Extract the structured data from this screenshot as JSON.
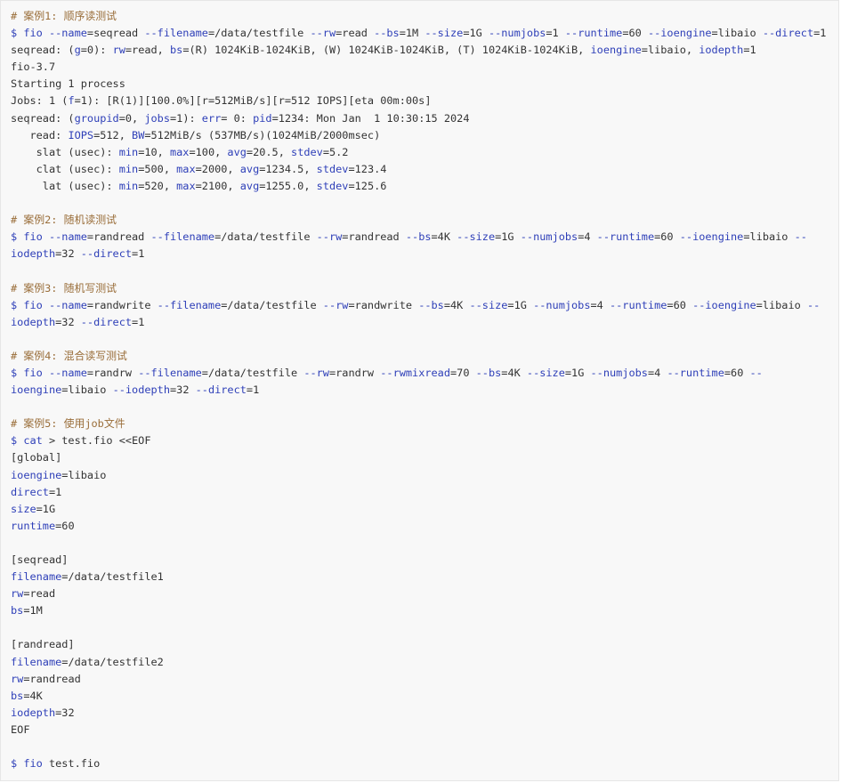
{
  "colors": {
    "background": "#f8f8f8",
    "border": "#e6e6e6",
    "text": "#333333",
    "comment": "#9a6e3a",
    "keyword": "#2e3fb8"
  },
  "lines": [
    [
      {
        "t": "comment",
        "v": "# 案例1: 顺序读测试"
      }
    ],
    [
      {
        "t": "prompt",
        "v": "$ fio "
      },
      {
        "t": "key",
        "v": "--name"
      },
      {
        "t": "plain",
        "v": "=seqread "
      },
      {
        "t": "key",
        "v": "--filename"
      },
      {
        "t": "plain",
        "v": "=/data/testfile "
      },
      {
        "t": "key",
        "v": "--rw"
      },
      {
        "t": "plain",
        "v": "=read "
      },
      {
        "t": "key",
        "v": "--bs"
      },
      {
        "t": "plain",
        "v": "=1M "
      },
      {
        "t": "key",
        "v": "--size"
      },
      {
        "t": "plain",
        "v": "=1G "
      },
      {
        "t": "key",
        "v": "--numjobs"
      },
      {
        "t": "plain",
        "v": "=1 "
      },
      {
        "t": "key",
        "v": "--runtime"
      },
      {
        "t": "plain",
        "v": "=60 "
      },
      {
        "t": "key",
        "v": "--ioengine"
      },
      {
        "t": "plain",
        "v": "=libaio "
      },
      {
        "t": "key",
        "v": "--direct"
      },
      {
        "t": "plain",
        "v": "=1"
      }
    ],
    [
      {
        "t": "plain",
        "v": "seqread: ("
      },
      {
        "t": "key",
        "v": "g"
      },
      {
        "t": "plain",
        "v": "=0): "
      },
      {
        "t": "key",
        "v": "rw"
      },
      {
        "t": "plain",
        "v": "=read, "
      },
      {
        "t": "key",
        "v": "bs"
      },
      {
        "t": "plain",
        "v": "=(R) 1024KiB-1024KiB, (W) 1024KiB-1024KiB, (T) 1024KiB-1024KiB, "
      },
      {
        "t": "key",
        "v": "ioengine"
      },
      {
        "t": "plain",
        "v": "=libaio, "
      },
      {
        "t": "key",
        "v": "iodepth"
      },
      {
        "t": "plain",
        "v": "=1"
      }
    ],
    [
      {
        "t": "plain",
        "v": "fio-3.7"
      }
    ],
    [
      {
        "t": "plain",
        "v": "Starting 1 process"
      }
    ],
    [
      {
        "t": "plain",
        "v": "Jobs: 1 ("
      },
      {
        "t": "key",
        "v": "f"
      },
      {
        "t": "plain",
        "v": "=1): [R(1)][100.0%][r=512MiB/s][r=512 IOPS][eta 00m:00s]"
      }
    ],
    [
      {
        "t": "plain",
        "v": "seqread: ("
      },
      {
        "t": "key",
        "v": "groupid"
      },
      {
        "t": "plain",
        "v": "=0, "
      },
      {
        "t": "key",
        "v": "jobs"
      },
      {
        "t": "plain",
        "v": "=1): "
      },
      {
        "t": "key",
        "v": "err"
      },
      {
        "t": "plain",
        "v": "= 0: "
      },
      {
        "t": "key",
        "v": "pid"
      },
      {
        "t": "plain",
        "v": "=1234: Mon Jan  1 10:30:15 2024"
      }
    ],
    [
      {
        "t": "plain",
        "v": "   read: "
      },
      {
        "t": "key",
        "v": "IOPS"
      },
      {
        "t": "plain",
        "v": "=512, "
      },
      {
        "t": "key",
        "v": "BW"
      },
      {
        "t": "plain",
        "v": "=512MiB/s (537MB/s)(1024MiB/2000msec)"
      }
    ],
    [
      {
        "t": "plain",
        "v": "    slat (usec): "
      },
      {
        "t": "key",
        "v": "min"
      },
      {
        "t": "plain",
        "v": "=10, "
      },
      {
        "t": "key",
        "v": "max"
      },
      {
        "t": "plain",
        "v": "=100, "
      },
      {
        "t": "key",
        "v": "avg"
      },
      {
        "t": "plain",
        "v": "=20.5, "
      },
      {
        "t": "key",
        "v": "stdev"
      },
      {
        "t": "plain",
        "v": "=5.2"
      }
    ],
    [
      {
        "t": "plain",
        "v": "    clat (usec): "
      },
      {
        "t": "key",
        "v": "min"
      },
      {
        "t": "plain",
        "v": "=500, "
      },
      {
        "t": "key",
        "v": "max"
      },
      {
        "t": "plain",
        "v": "=2000, "
      },
      {
        "t": "key",
        "v": "avg"
      },
      {
        "t": "plain",
        "v": "=1234.5, "
      },
      {
        "t": "key",
        "v": "stdev"
      },
      {
        "t": "plain",
        "v": "=123.4"
      }
    ],
    [
      {
        "t": "plain",
        "v": "     lat (usec): "
      },
      {
        "t": "key",
        "v": "min"
      },
      {
        "t": "plain",
        "v": "=520, "
      },
      {
        "t": "key",
        "v": "max"
      },
      {
        "t": "plain",
        "v": "=2100, "
      },
      {
        "t": "key",
        "v": "avg"
      },
      {
        "t": "plain",
        "v": "=1255.0, "
      },
      {
        "t": "key",
        "v": "stdev"
      },
      {
        "t": "plain",
        "v": "=125.6"
      }
    ],
    [],
    [
      {
        "t": "comment",
        "v": "# 案例2: 随机读测试"
      }
    ],
    [
      {
        "t": "prompt",
        "v": "$ fio "
      },
      {
        "t": "key",
        "v": "--name"
      },
      {
        "t": "plain",
        "v": "=randread "
      },
      {
        "t": "key",
        "v": "--filename"
      },
      {
        "t": "plain",
        "v": "=/data/testfile "
      },
      {
        "t": "key",
        "v": "--rw"
      },
      {
        "t": "plain",
        "v": "=randread "
      },
      {
        "t": "key",
        "v": "--bs"
      },
      {
        "t": "plain",
        "v": "=4K "
      },
      {
        "t": "key",
        "v": "--size"
      },
      {
        "t": "plain",
        "v": "=1G "
      },
      {
        "t": "key",
        "v": "--numjobs"
      },
      {
        "t": "plain",
        "v": "=4 "
      },
      {
        "t": "key",
        "v": "--runtime"
      },
      {
        "t": "plain",
        "v": "=60 "
      },
      {
        "t": "key",
        "v": "--ioengine"
      },
      {
        "t": "plain",
        "v": "=libaio "
      },
      {
        "t": "key",
        "v": "--"
      }
    ],
    [
      {
        "t": "key",
        "v": "iodepth"
      },
      {
        "t": "plain",
        "v": "=32 "
      },
      {
        "t": "key",
        "v": "--direct"
      },
      {
        "t": "plain",
        "v": "=1"
      }
    ],
    [],
    [
      {
        "t": "comment",
        "v": "# 案例3: 随机写测试"
      }
    ],
    [
      {
        "t": "prompt",
        "v": "$ fio "
      },
      {
        "t": "key",
        "v": "--name"
      },
      {
        "t": "plain",
        "v": "=randwrite "
      },
      {
        "t": "key",
        "v": "--filename"
      },
      {
        "t": "plain",
        "v": "=/data/testfile "
      },
      {
        "t": "key",
        "v": "--rw"
      },
      {
        "t": "plain",
        "v": "=randwrite "
      },
      {
        "t": "key",
        "v": "--bs"
      },
      {
        "t": "plain",
        "v": "=4K "
      },
      {
        "t": "key",
        "v": "--size"
      },
      {
        "t": "plain",
        "v": "=1G "
      },
      {
        "t": "key",
        "v": "--numjobs"
      },
      {
        "t": "plain",
        "v": "=4 "
      },
      {
        "t": "key",
        "v": "--runtime"
      },
      {
        "t": "plain",
        "v": "=60 "
      },
      {
        "t": "key",
        "v": "--ioengine"
      },
      {
        "t": "plain",
        "v": "=libaio "
      },
      {
        "t": "key",
        "v": "--"
      }
    ],
    [
      {
        "t": "key",
        "v": "iodepth"
      },
      {
        "t": "plain",
        "v": "=32 "
      },
      {
        "t": "key",
        "v": "--direct"
      },
      {
        "t": "plain",
        "v": "=1"
      }
    ],
    [],
    [
      {
        "t": "comment",
        "v": "# 案例4: 混合读写测试"
      }
    ],
    [
      {
        "t": "prompt",
        "v": "$ fio "
      },
      {
        "t": "key",
        "v": "--name"
      },
      {
        "t": "plain",
        "v": "=randrw "
      },
      {
        "t": "key",
        "v": "--filename"
      },
      {
        "t": "plain",
        "v": "=/data/testfile "
      },
      {
        "t": "key",
        "v": "--rw"
      },
      {
        "t": "plain",
        "v": "=randrw "
      },
      {
        "t": "key",
        "v": "--rwmixread"
      },
      {
        "t": "plain",
        "v": "=70 "
      },
      {
        "t": "key",
        "v": "--bs"
      },
      {
        "t": "plain",
        "v": "=4K "
      },
      {
        "t": "key",
        "v": "--size"
      },
      {
        "t": "plain",
        "v": "=1G "
      },
      {
        "t": "key",
        "v": "--numjobs"
      },
      {
        "t": "plain",
        "v": "=4 "
      },
      {
        "t": "key",
        "v": "--runtime"
      },
      {
        "t": "plain",
        "v": "=60 "
      },
      {
        "t": "key",
        "v": "--"
      }
    ],
    [
      {
        "t": "key",
        "v": "ioengine"
      },
      {
        "t": "plain",
        "v": "=libaio "
      },
      {
        "t": "key",
        "v": "--iodepth"
      },
      {
        "t": "plain",
        "v": "=32 "
      },
      {
        "t": "key",
        "v": "--direct"
      },
      {
        "t": "plain",
        "v": "=1"
      }
    ],
    [],
    [
      {
        "t": "comment",
        "v": "# 案例5: 使用job文件"
      }
    ],
    [
      {
        "t": "prompt",
        "v": "$ cat"
      },
      {
        "t": "plain",
        "v": " > test.fio <<EOF"
      }
    ],
    [
      {
        "t": "plain",
        "v": "[global]"
      }
    ],
    [
      {
        "t": "key",
        "v": "ioengine"
      },
      {
        "t": "plain",
        "v": "=libaio"
      }
    ],
    [
      {
        "t": "key",
        "v": "direct"
      },
      {
        "t": "plain",
        "v": "=1"
      }
    ],
    [
      {
        "t": "key",
        "v": "size"
      },
      {
        "t": "plain",
        "v": "=1G"
      }
    ],
    [
      {
        "t": "key",
        "v": "runtime"
      },
      {
        "t": "plain",
        "v": "=60"
      }
    ],
    [],
    [
      {
        "t": "plain",
        "v": "[seqread]"
      }
    ],
    [
      {
        "t": "key",
        "v": "filename"
      },
      {
        "t": "plain",
        "v": "=/data/testfile1"
      }
    ],
    [
      {
        "t": "key",
        "v": "rw"
      },
      {
        "t": "plain",
        "v": "=read"
      }
    ],
    [
      {
        "t": "key",
        "v": "bs"
      },
      {
        "t": "plain",
        "v": "=1M"
      }
    ],
    [],
    [
      {
        "t": "plain",
        "v": "[randread]"
      }
    ],
    [
      {
        "t": "key",
        "v": "filename"
      },
      {
        "t": "plain",
        "v": "=/data/testfile2"
      }
    ],
    [
      {
        "t": "key",
        "v": "rw"
      },
      {
        "t": "plain",
        "v": "=randread"
      }
    ],
    [
      {
        "t": "key",
        "v": "bs"
      },
      {
        "t": "plain",
        "v": "=4K"
      }
    ],
    [
      {
        "t": "key",
        "v": "iodepth"
      },
      {
        "t": "plain",
        "v": "=32"
      }
    ],
    [
      {
        "t": "plain",
        "v": "EOF"
      }
    ],
    [],
    [
      {
        "t": "prompt",
        "v": "$ fio"
      },
      {
        "t": "plain",
        "v": " test.fio"
      }
    ]
  ]
}
